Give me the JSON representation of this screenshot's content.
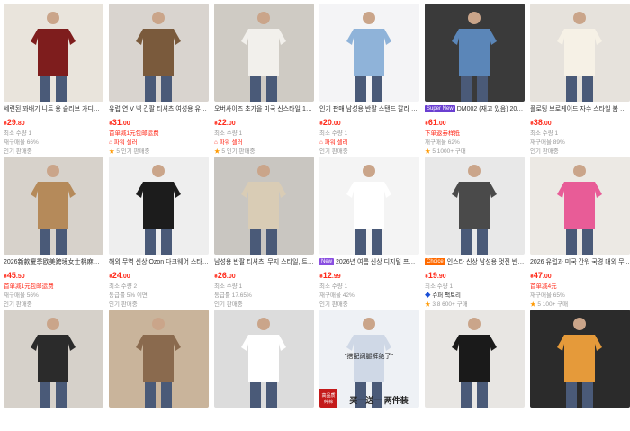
{
  "products": [
    {
      "title": "세련된 꽈배기 니트 용 슬리브 가디건 2...",
      "badge": "",
      "price_int": "29",
      "price_cents": ".80",
      "currency": "¥",
      "lines": [
        {
          "type": "meta",
          "text": "최소 수량 1"
        },
        {
          "type": "meta",
          "text": "재구매율 66%"
        },
        {
          "type": "meta",
          "text": "인기 판매중"
        }
      ],
      "colors": [
        "#e9e4dc",
        "#7e1d1d"
      ]
    },
    {
      "title": "유럽 연 V 넥 긴팔 티셔츠 여성용 유럽 ...",
      "badge": "",
      "price_int": "31",
      "price_cents": ".00",
      "currency": "¥",
      "lines": [
        {
          "type": "promo",
          "text": "首单减1元包邮运费"
        },
        {
          "type": "tag",
          "text": "파워 셀러"
        },
        {
          "type": "rating",
          "star": "★",
          "text": "5 인기 판매중"
        }
      ],
      "colors": [
        "#d9d4cf",
        "#7a5a3c"
      ]
    },
    {
      "title": "오버사이즈 초가을 미국 신스타일 100...",
      "badge": "",
      "price_int": "22",
      "price_cents": ".00",
      "currency": "¥",
      "lines": [
        {
          "type": "meta",
          "text": "최소 수량 1"
        },
        {
          "type": "tag",
          "text": "파워 셀러"
        },
        {
          "type": "rating",
          "star": "★",
          "text": "5 인기 판매중"
        }
      ],
      "colors": [
        "#cfcbc4",
        "#f2f0ec"
      ]
    },
    {
      "title": "인기 판매 남성용 반팔 스탠드 칼라 티...",
      "badge": "",
      "price_int": "20",
      "price_cents": ".00",
      "currency": "¥",
      "lines": [
        {
          "type": "meta",
          "text": "최소 수량 1"
        },
        {
          "type": "tag",
          "text": "파워 셀러"
        },
        {
          "type": "meta",
          "text": "인기 판매중"
        }
      ],
      "colors": [
        "#f4f4f6",
        "#8fb3d9"
      ]
    },
    {
      "title": "DM002 (재고 있음) 202...",
      "badge": "Super New",
      "badge_color": "#6a3fd1",
      "price_int": "61",
      "price_cents": ".00",
      "currency": "¥",
      "lines": [
        {
          "type": "promo",
          "text": "下单返券样抵"
        },
        {
          "type": "meta",
          "text": "재구매율 62%"
        },
        {
          "type": "rating",
          "star": "★",
          "text": "5 1000+ 구매"
        }
      ],
      "colors": [
        "#3a3a3a",
        "#5b86b8"
      ]
    },
    {
      "title": "플로팅 브로케이드 자수 스타일 봄 여...",
      "badge": "",
      "price_int": "38",
      "price_cents": ".00",
      "currency": "¥",
      "lines": [
        {
          "type": "meta",
          "text": "최소 수량 1"
        },
        {
          "type": "meta",
          "text": "재구매율 89%"
        },
        {
          "type": "meta",
          "text": "인기 판매중"
        }
      ],
      "colors": [
        "#e6e2dc",
        "#f6f1e6"
      ]
    },
    {
      "title": "2026新款夏季欧美跨境女士棉麻时...",
      "badge": "",
      "price_int": "45",
      "price_cents": ".50",
      "currency": "¥",
      "lines": [
        {
          "type": "promo",
          "text": "首单减1元包邮运费"
        },
        {
          "type": "meta",
          "text": "재구매율 56%"
        },
        {
          "type": "meta",
          "text": "인기 판매중"
        }
      ],
      "colors": [
        "#d7d2cb",
        "#b58a5a"
      ]
    },
    {
      "title": "해외 무역 신상 Ozon 다크웨어 스타일...",
      "badge": "",
      "price_int": "24",
      "price_cents": ".00",
      "currency": "¥",
      "lines": [
        {
          "type": "meta",
          "text": "최소 수량 2"
        },
        {
          "type": "meta",
          "text": "동급률 5% 이면"
        },
        {
          "type": "meta",
          "text": "인기 판매중"
        }
      ],
      "colors": [
        "#eeeeee",
        "#1c1c1c"
      ]
    },
    {
      "title": "남성용 반팔 티셔츠, 무지 스타일, 트렌...",
      "badge": "",
      "price_int": "26",
      "price_cents": ".00",
      "currency": "¥",
      "lines": [
        {
          "type": "meta",
          "text": "최소 수량 1"
        },
        {
          "type": "meta",
          "text": "동급률 17.65%"
        },
        {
          "type": "meta",
          "text": "인기 판매중"
        }
      ],
      "colors": [
        "#c9c6c1",
        "#d9ccb5"
      ]
    },
    {
      "title": "2026년 여름 신상 디지털 프린...",
      "badge": "New",
      "badge_color": "#8a4fe0",
      "price_int": "12",
      "price_cents": ".99",
      "currency": "¥",
      "lines": [
        {
          "type": "meta",
          "text": "최소 수량 1"
        },
        {
          "type": "meta",
          "text": "재구매율 42%"
        },
        {
          "type": "meta",
          "text": "인기 판매중"
        }
      ],
      "colors": [
        "#f4f4f4",
        "#ffffff"
      ]
    },
    {
      "title": "인스타 신상 남성용 멋진 반소...",
      "badge": "Choice",
      "badge_color": "#ff6a00",
      "price_int": "19",
      "price_cents": ".90",
      "currency": "¥",
      "lines": [
        {
          "type": "meta",
          "text": "최소 수량 1"
        },
        {
          "type": "shop",
          "icon": "◆",
          "text": "슈퍼 팩토리"
        },
        {
          "type": "rating",
          "star": "★",
          "text": "3.8 600+ 구매"
        }
      ],
      "colors": [
        "#e8e8e8",
        "#4a4a4a"
      ]
    },
    {
      "title": "2026 유럽과 미국 간워 국경 대외 무...",
      "badge": "",
      "price_int": "47",
      "price_cents": ".00",
      "currency": "¥",
      "lines": [
        {
          "type": "promo",
          "text": "首单减4元"
        },
        {
          "type": "meta",
          "text": "재구매율 65%"
        },
        {
          "type": "rating",
          "star": "★",
          "text": "5 100+ 구매"
        }
      ],
      "colors": [
        "#ece9e4",
        "#e85c97"
      ]
    },
    {
      "title": "",
      "badge": "",
      "price_int": "",
      "price_cents": "",
      "currency": "",
      "lines": [],
      "colors": [
        "#d6d1ca",
        "#2b2b2b"
      ]
    },
    {
      "title": "",
      "badge": "",
      "price_int": "",
      "price_cents": "",
      "currency": "",
      "lines": [],
      "colors": [
        "#c9b49b",
        "#8a6a4e"
      ]
    },
    {
      "title": "",
      "badge": "",
      "price_int": "",
      "price_cents": "",
      "currency": "",
      "lines": [],
      "colors": [
        "#dcdcdc",
        "#ffffff"
      ]
    },
    {
      "title": "",
      "badge": "",
      "price_int": "",
      "price_cents": "",
      "currency": "",
      "lines": [],
      "colors": [
        "#eef1f5",
        "#cfd8e6"
      ],
      "overlay_text": "\"搭配阔腿裤绝了\"",
      "bottom_left": "高品质\n纯棉",
      "bottom_right": "买一送一 两件装"
    },
    {
      "title": "",
      "badge": "",
      "price_int": "",
      "price_cents": "",
      "currency": "",
      "lines": [],
      "colors": [
        "#e8e6e3",
        "#1a1a1a"
      ]
    },
    {
      "title": "",
      "badge": "",
      "price_int": "",
      "price_cents": "",
      "currency": "",
      "lines": [],
      "colors": [
        "#2b2b2b",
        "#e59a3a"
      ]
    }
  ]
}
